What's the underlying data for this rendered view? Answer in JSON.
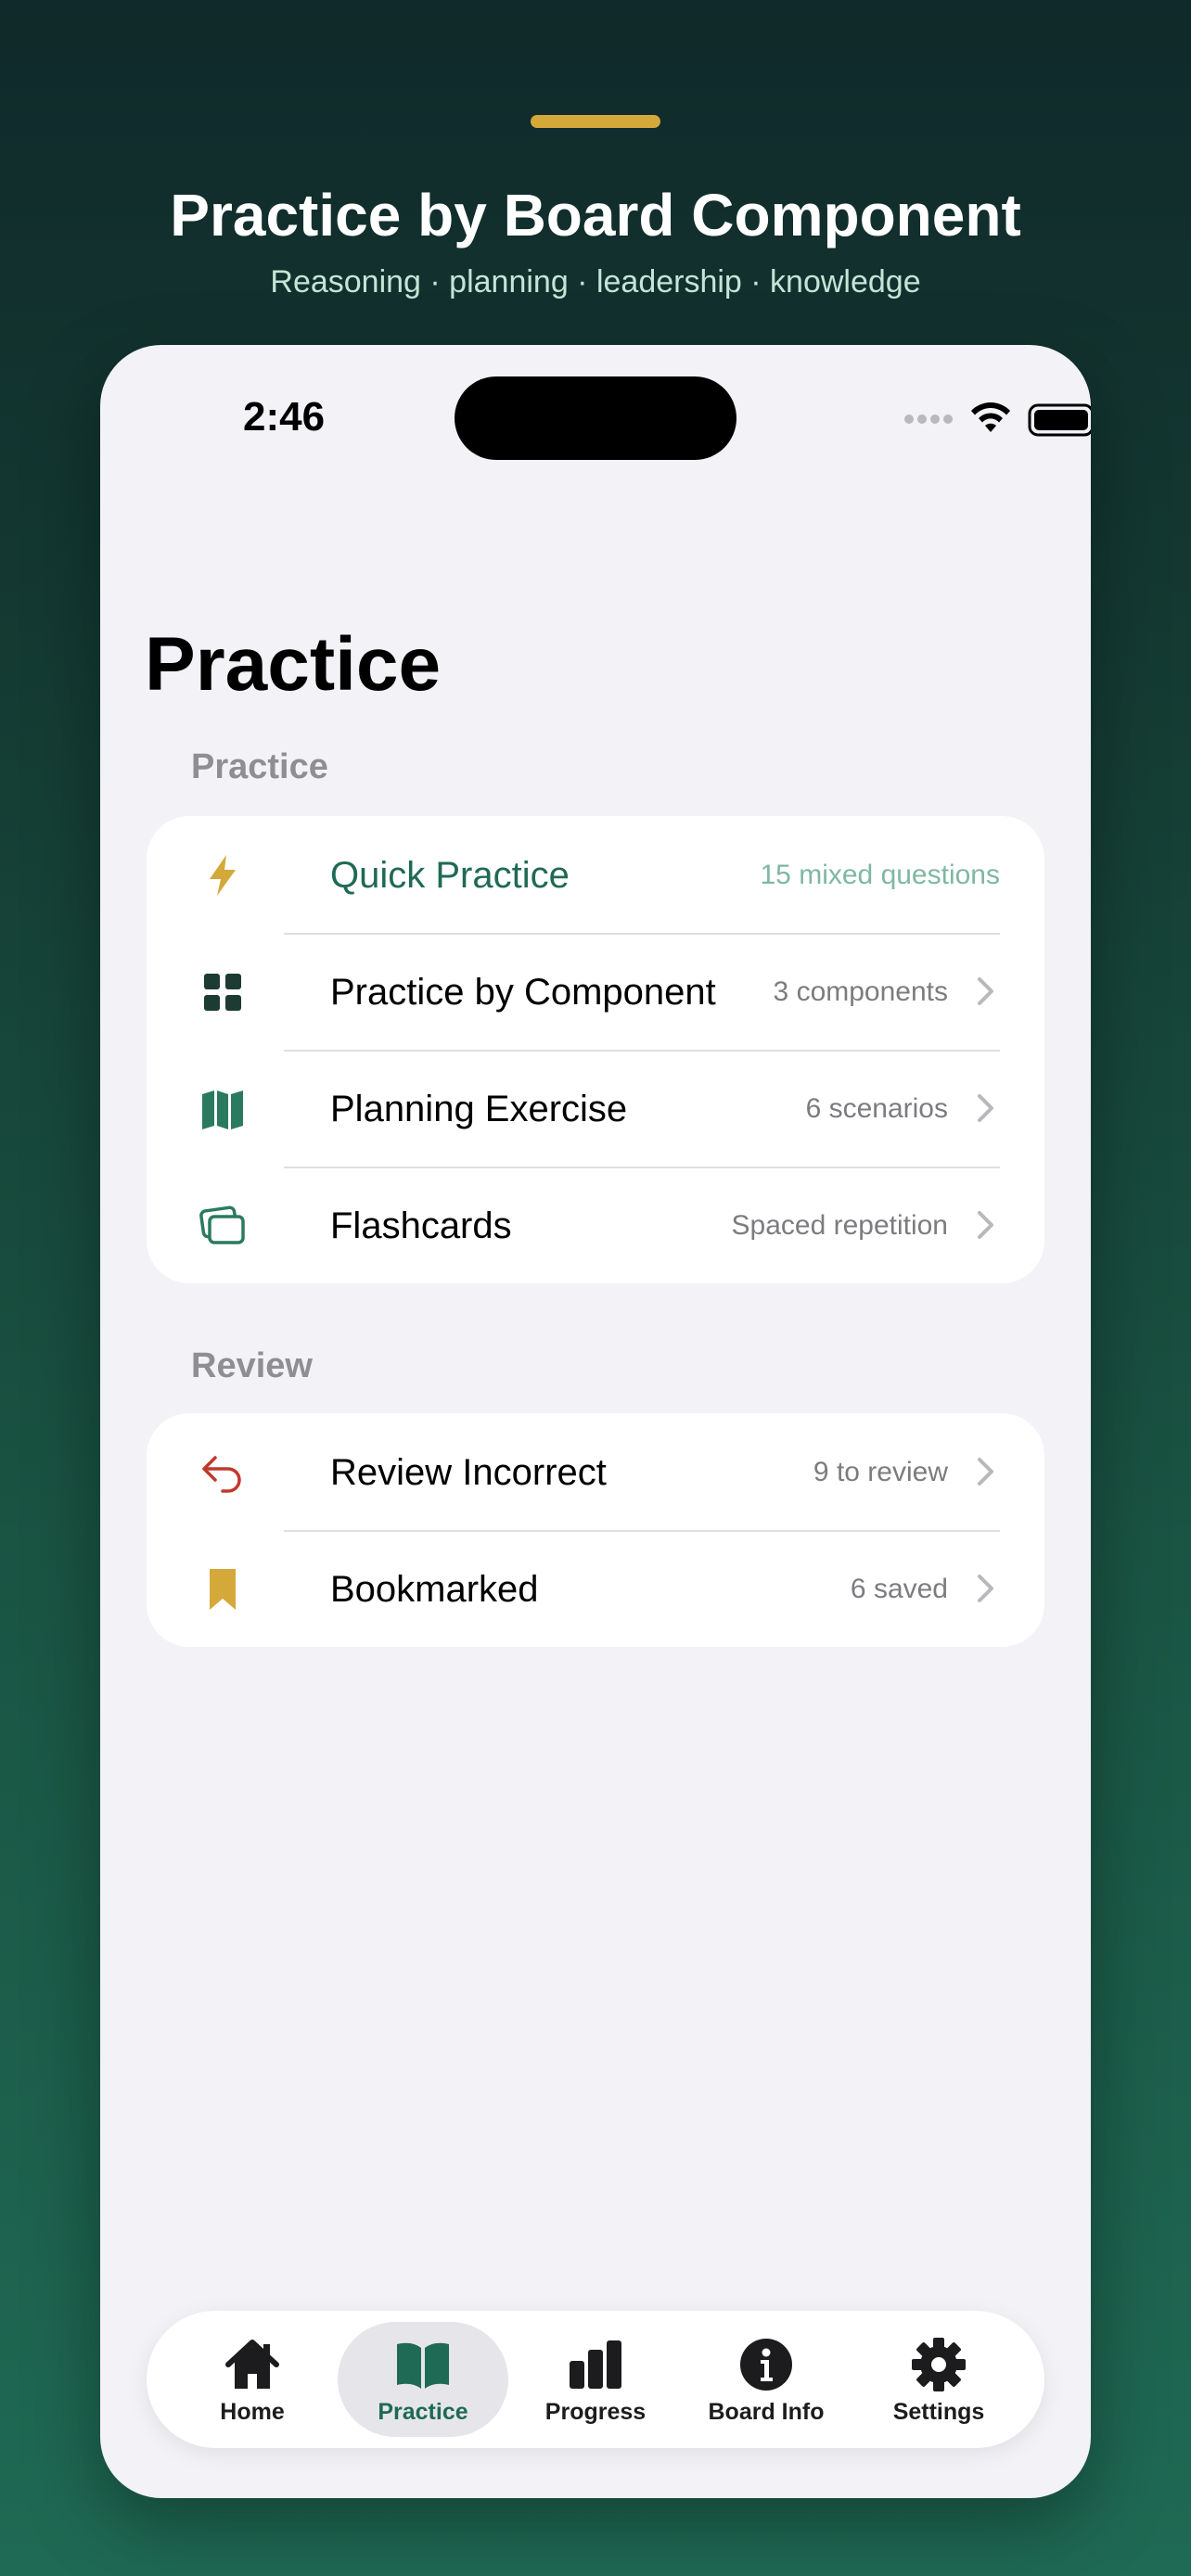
{
  "hero": {
    "title": "Practice by Board Component",
    "subtitle": "Reasoning · planning · leadership · knowledge"
  },
  "status_bar": {
    "time": "2:46"
  },
  "page": {
    "title": "Practice"
  },
  "sections": {
    "practice": {
      "header": "Practice",
      "items": [
        {
          "label": "Quick Practice",
          "detail": "15 mixed questions",
          "icon": "bolt-icon",
          "highlighted": true
        },
        {
          "label": "Practice by Component",
          "detail": "3 components",
          "icon": "grid-icon"
        },
        {
          "label": "Planning Exercise",
          "detail": "6 scenarios",
          "icon": "map-icon"
        },
        {
          "label": "Flashcards",
          "detail": "Spaced repetition",
          "icon": "cards-icon"
        }
      ]
    },
    "review": {
      "header": "Review",
      "items": [
        {
          "label": "Review Incorrect",
          "detail": "9 to review",
          "icon": "undo-arrow-icon"
        },
        {
          "label": "Bookmarked",
          "detail": "6 saved",
          "icon": "bookmark-icon"
        }
      ]
    }
  },
  "tabbar": {
    "tabs": [
      {
        "label": "Home",
        "icon": "house-icon"
      },
      {
        "label": "Practice",
        "icon": "book-icon",
        "active": true
      },
      {
        "label": "Progress",
        "icon": "bar-chart-icon"
      },
      {
        "label": "Board Info",
        "icon": "info-icon"
      },
      {
        "label": "Settings",
        "icon": "gear-icon"
      }
    ]
  },
  "colors": {
    "accent_green": "#1f6a54",
    "gold": "#d4a93a",
    "alert_red": "#c0392b",
    "quick_detail": "#7fb8a2"
  }
}
